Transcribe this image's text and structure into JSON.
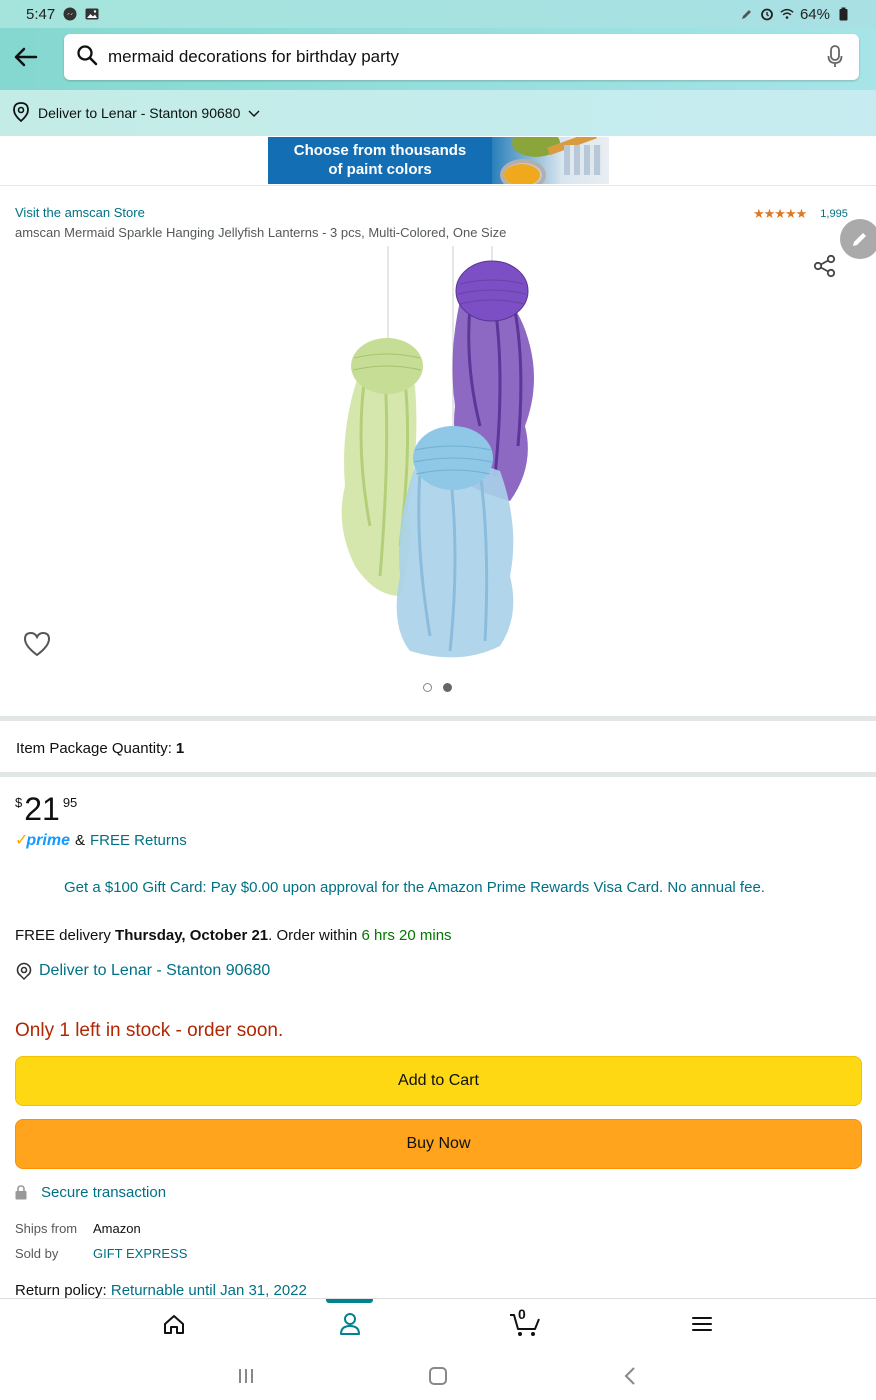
{
  "status_bar": {
    "time": "5:47",
    "battery": "64%"
  },
  "search": {
    "query": "mermaid decorations for birthday party"
  },
  "delivery_bar": {
    "text": "Deliver to Lenar - Stanton 90680"
  },
  "banner": {
    "line1": "Choose from thousands",
    "line2": "of paint colors"
  },
  "product": {
    "store_link": "Visit the amscan Store",
    "title": "amscan Mermaid Sparkle Hanging Jellyfish Lanterns - 3 pcs, Multi-Colored, One Size",
    "rating_stars": "★★★★★",
    "rating_value": 4.5,
    "rating_count": "1,995",
    "image_count": 2,
    "active_image": 2
  },
  "quantity": {
    "label": "Item Package Quantity:",
    "value": "1"
  },
  "price": {
    "symbol": "$",
    "whole": "21",
    "fraction": "95"
  },
  "prime": {
    "logo": "prime",
    "amp": "&",
    "free_returns": "FREE Returns"
  },
  "gift_card": "Get a $100 Gift Card: Pay $0.00 upon approval for the Amazon Prime Rewards Visa Card. No annual fee.",
  "delivery": {
    "prefix": "FREE delivery ",
    "date": "Thursday, October 21",
    "middle": ". Order within ",
    "countdown": "6 hrs 20 mins",
    "deliver_to": "Deliver to Lenar - Stanton 90680"
  },
  "stock": "Only 1 left in stock - order soon.",
  "buttons": {
    "add_to_cart": "Add to Cart",
    "buy_now": "Buy Now"
  },
  "secure": "Secure transaction",
  "ships_from": {
    "label": "Ships from",
    "value": "Amazon"
  },
  "sold_by": {
    "label": "Sold by",
    "value": "GIFT EXPRESS"
  },
  "return_policy": {
    "label": "Return policy: ",
    "value": "Returnable until Jan 31, 2022"
  },
  "bottom_nav": {
    "cart_count": "0",
    "active": "account"
  },
  "colors": {
    "accent": "#007185",
    "add_to_cart": "#ffd814",
    "buy_now": "#ffa41c",
    "stock_red": "#b12704",
    "green": "#007600"
  }
}
